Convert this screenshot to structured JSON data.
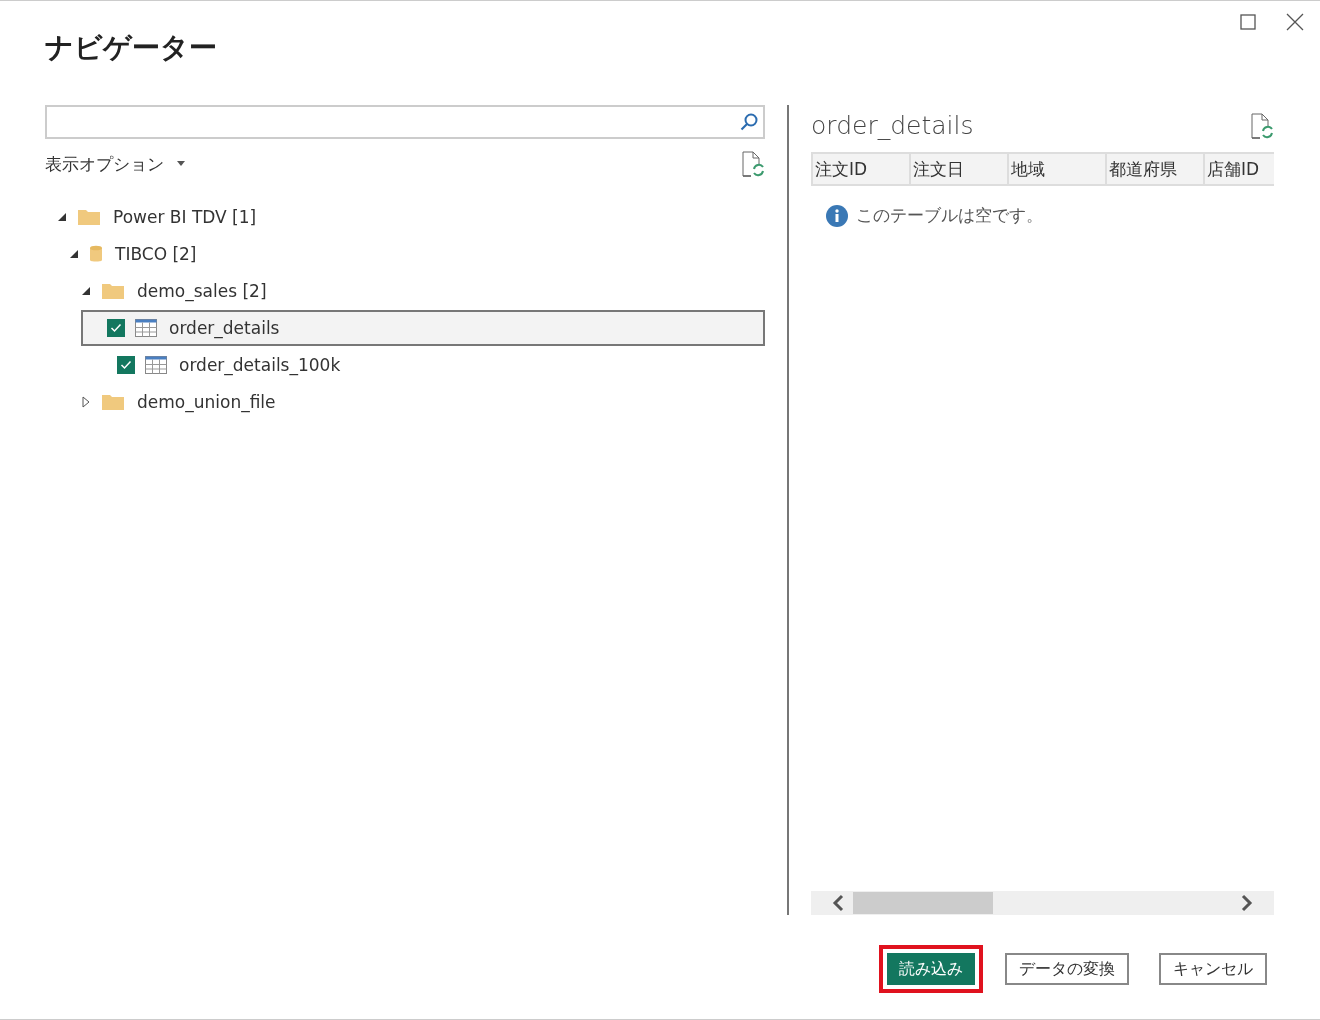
{
  "window": {
    "title": "ナビゲーター"
  },
  "display_options": {
    "label": "表示オプション"
  },
  "tree": [
    {
      "label": "Power BI TDV [1]",
      "kind": "folder",
      "expanded": true,
      "children": [
        {
          "label": "TIBCO [2]",
          "kind": "database",
          "expanded": true,
          "children": [
            {
              "label": "demo_sales [2]",
              "kind": "folder",
              "expanded": true,
              "children": [
                {
                  "label": "order_details",
                  "kind": "table",
                  "checked": true,
                  "selected": true
                },
                {
                  "label": "order_details_100k",
                  "kind": "table",
                  "checked": true,
                  "selected": false
                }
              ]
            },
            {
              "label": "demo_union_file",
              "kind": "folder",
              "expanded": false
            }
          ]
        }
      ]
    }
  ],
  "preview": {
    "title": "order_details",
    "columns": [
      "注文ID",
      "注文日",
      "地域",
      "都道府県",
      "店舗ID"
    ],
    "message": "このテーブルは空です。"
  },
  "buttons": [
    {
      "label": "読み込み",
      "kind": "primary",
      "highlighted": true
    },
    {
      "label": "データの変換",
      "kind": "secondary",
      "highlighted": false
    },
    {
      "label": "キャンセル",
      "kind": "secondary",
      "highlighted": false
    }
  ]
}
